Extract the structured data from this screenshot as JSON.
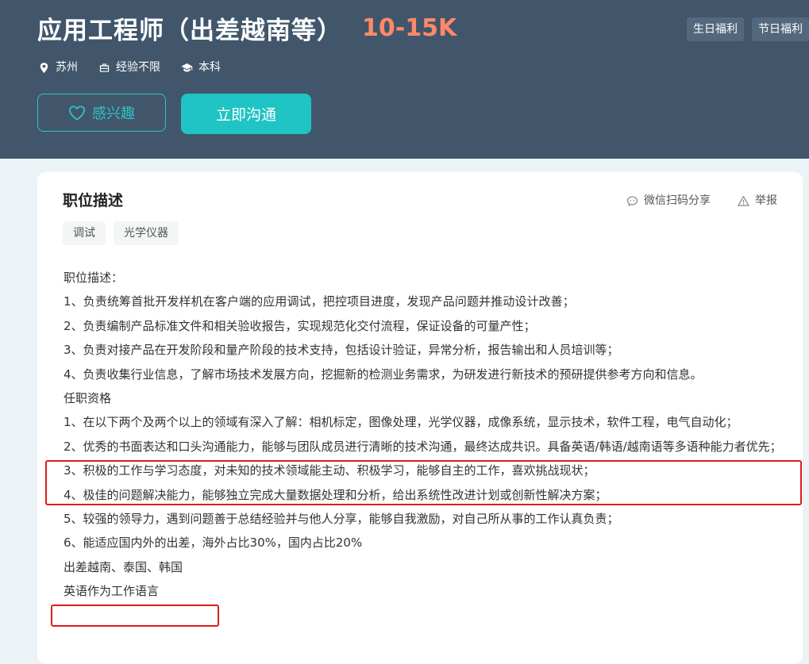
{
  "job": {
    "title": "应用工程师（出差越南等）",
    "salary": "10-15K",
    "location": "苏州",
    "experience": "经验不限",
    "education": "本科"
  },
  "benefits": [
    "生日福利",
    "节日福利"
  ],
  "actions": {
    "interest_label": "感兴趣",
    "chat_label": "立即沟通"
  },
  "section": {
    "title": "职位描述",
    "share_label": "微信扫码分享",
    "report_label": "举报"
  },
  "tags": [
    "调试",
    "光学仪器"
  ],
  "description": [
    "职位描述：",
    "1、负责统筹首批开发样机在客户端的应用调试，把控项目进度，发现产品问题并推动设计改善；",
    "2、负责编制产品标准文件和相关验收报告，实现规范化交付流程，保证设备的可量产性；",
    "3、负责对接产品在开发阶段和量产阶段的技术支持，包括设计验证，异常分析，报告输出和人员培训等；",
    "4、负责收集行业信息，了解市场技术发展方向，挖掘新的检测业务需求，为研发进行新技术的预研提供参考方向和信息。",
    "任职资格",
    "1、在以下两个及两个以上的领域有深入了解：相机标定，图像处理，光学仪器，成像系统，显示技术，软件工程，电气自动化；",
    "2、优秀的书面表达和口头沟通能力，能够与团队成员进行清晰的技术沟通，最终达成共识。具备英语/韩语/越南语等多语种能力者优先；",
    "3、积极的工作与学习态度，对未知的技术领域能主动、积极学习，能够自主的工作，喜欢挑战现状；",
    "4、极佳的问题解决能力，能够独立完成大量数据处理和分析，给出系统性改进计划或创新性解决方案；",
    "5、较强的领导力，遇到问题善于总结经验并与他人分享，能够自我激励，对自己所从事的工作认真负责；",
    "6、能适应国内外的出差，海外占比30%，国内占比20%",
    "出差越南、泰国、韩国",
    "英语作为工作语言"
  ],
  "colors": {
    "header_bg": "#41566b",
    "salary": "#ff8969",
    "accent": "#1fc4c4",
    "highlight": "#e01b1b"
  }
}
